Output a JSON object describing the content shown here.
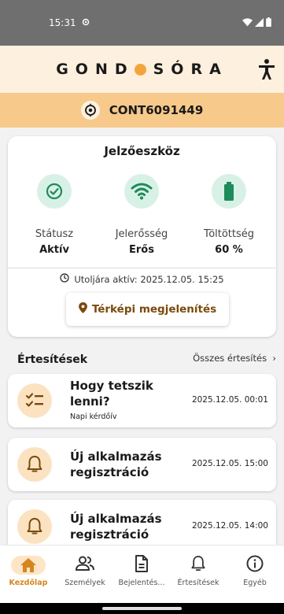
{
  "status_bar": {
    "time": "15:31"
  },
  "brand": {
    "part1": "GOND",
    "part2": "SÓRA"
  },
  "device": {
    "id": "CONT6091449"
  },
  "device_card": {
    "title": "Jelzőeszköz",
    "metrics": [
      {
        "label": "Státusz",
        "value": "Aktív"
      },
      {
        "label": "Jelerősség",
        "value": "Erős"
      },
      {
        "label": "Töltöttség",
        "value": "60 %"
      }
    ],
    "last_active": "Utoljára aktív: 2025.12.05. 15:25",
    "map_button": "Térképi megjelenítés"
  },
  "notifications": {
    "header": "Értesítések",
    "all_link": "Összes értesítés",
    "items": [
      {
        "title": "Hogy tetszik lenni?",
        "subtitle": "Napi kérdőív",
        "date": "2025.12.05. 00:01",
        "icon": "checklist-icon"
      },
      {
        "title": "Új alkalmazás regisztráció",
        "subtitle": "",
        "date": "2025.12.05. 15:00",
        "icon": "bell-icon"
      },
      {
        "title": "Új alkalmazás regisztráció",
        "subtitle": "",
        "date": "2025.12.05. 14:00",
        "icon": "bell-icon"
      }
    ]
  },
  "bottom_nav": [
    {
      "label": "Kezdőlap",
      "active": true
    },
    {
      "label": "Személyek",
      "active": false
    },
    {
      "label": "Bejelentés...",
      "active": false
    },
    {
      "label": "Értesítések",
      "active": false
    },
    {
      "label": "Egyéb",
      "active": false
    }
  ],
  "colors": {
    "accent": "#f3a53b",
    "brand_bg": "#fdf0de",
    "device_bar": "#f7c98a",
    "status_green": "#1f8a5b",
    "active_nav": "#d4861f"
  }
}
